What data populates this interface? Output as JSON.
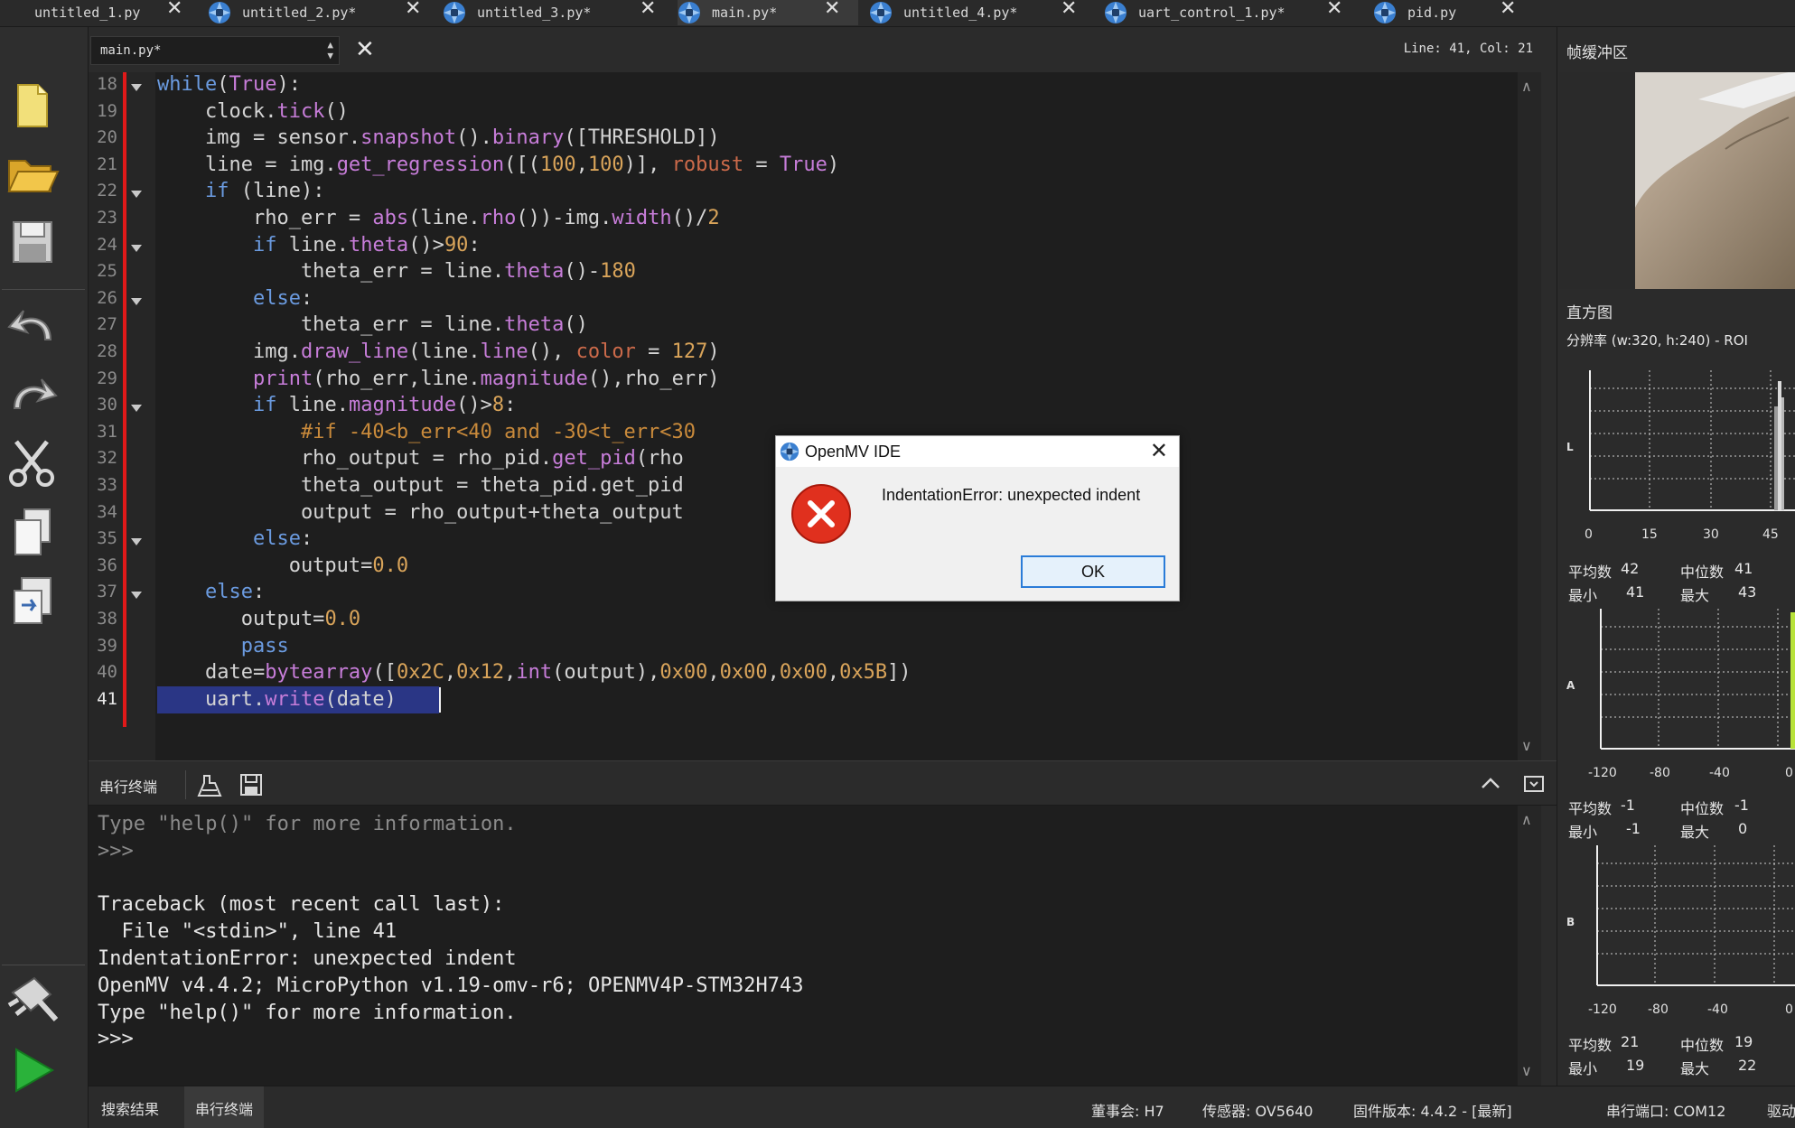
{
  "tabs": [
    {
      "label": "untitled_1.py",
      "active": false
    },
    {
      "label": "untitled_2.py*",
      "active": false
    },
    {
      "label": "untitled_3.py*",
      "active": false
    },
    {
      "label": "main.py*",
      "active": true
    },
    {
      "label": "untitled_4.py*",
      "active": false
    },
    {
      "label": "uart_control_1.py*",
      "active": false
    },
    {
      "label": "pid.py",
      "active": false
    }
  ],
  "editor": {
    "file_combo": "main.py*",
    "line_col": "Line: 41, Col: 21",
    "line_numbers": [
      "18",
      "19",
      "20",
      "21",
      "22",
      "23",
      "24",
      "25",
      "26",
      "27",
      "28",
      "29",
      "30",
      "31",
      "32",
      "33",
      "34",
      "35",
      "36",
      "37",
      "38",
      "39",
      "40",
      "41"
    ],
    "code": [
      "while(True):",
      "    clock.tick()",
      "    img = sensor.snapshot().binary([THRESHOLD])",
      "    line = img.get_regression([(100,100)], robust = True)",
      "    if (line):",
      "        rho_err = abs(line.rho())-img.width()/2",
      "        if line.theta()>90:",
      "            theta_err = line.theta()-180",
      "        else:",
      "            theta_err = line.theta()",
      "        img.draw_line(line.line(), color = 127)",
      "        print(rho_err,line.magnitude(),rho_err)",
      "        if line.magnitude()>8:",
      "            #if -40<b_err<40 and -30<t_err<30",
      "            rho_output = rho_pid.get_pid(rho",
      "            theta_output = theta_pid.get_pid",
      "            output = rho_output+theta_output",
      "        else:",
      "           output=0.0",
      "    else:",
      "       output=0.0",
      "       pass",
      "    date=bytearray([0x2C,0x12,int(output),0x00,0x00,0x00,0x5B])",
      "    uart.write(date)"
    ]
  },
  "terminal": {
    "title": "串行终端",
    "lines": [
      "Type \"help()\" for more information.",
      ">>>",
      "",
      "Traceback (most recent call last):",
      "  File \"<stdin>\", line 41",
      "IndentationError: unexpected indent",
      "OpenMV v4.4.2; MicroPython v1.19-omv-r6; OPENMV4P-STM32H743",
      "Type \"help()\" for more information.",
      ">>>"
    ]
  },
  "statusbar": {
    "tab_search": "搜索结果",
    "tab_serial": "串行终端",
    "board": "董事会: H7",
    "sensor": "传感器: OV5640",
    "firmware": "固件版本: 4.4.2 - [最新]",
    "port": "串行端口: COM12",
    "driver": "驱动"
  },
  "right_panel": {
    "framebuffer_title": "帧缓冲区",
    "histogram_title": "直方图",
    "resolution": "分辨率 (w:320, h:240) - ROI",
    "hist1": {
      "channel": "L",
      "ticks": [
        "0",
        "15",
        "30",
        "45"
      ],
      "stats": {
        "mean_label": "平均数",
        "mean": "42",
        "median_label": "中位数",
        "median": "41",
        "min_label": "最小",
        "min": "41",
        "max_label": "最大",
        "max": "43"
      }
    },
    "hist2": {
      "channel": "A",
      "ticks": [
        "-120",
        "-80",
        "-40",
        "0"
      ],
      "stats": {
        "mean_label": "平均数",
        "mean": "-1",
        "median_label": "中位数",
        "median": "-1",
        "min_label": "最小",
        "min": "-1",
        "max_label": "最大",
        "max": "0"
      }
    },
    "hist3": {
      "channel": "B",
      "ticks": [
        "-120",
        "-80",
        "-40",
        "0"
      ],
      "stats": {
        "mean_label": "平均数",
        "mean": "21",
        "median_label": "中位数",
        "median": "19",
        "min_label": "最小",
        "min": "19",
        "max_label": "最大",
        "max": "22"
      }
    }
  },
  "dialog": {
    "title": "OpenMV IDE",
    "message": "IndentationError: unexpected indent",
    "ok_label": "OK"
  },
  "colors": {
    "editor_bg": "#1e1e1e",
    "keyword": "#6b9be0",
    "function": "#c77dd9",
    "number": "#d9a45a",
    "change_marker": "#e01919",
    "error_icon": "#e0301e"
  }
}
